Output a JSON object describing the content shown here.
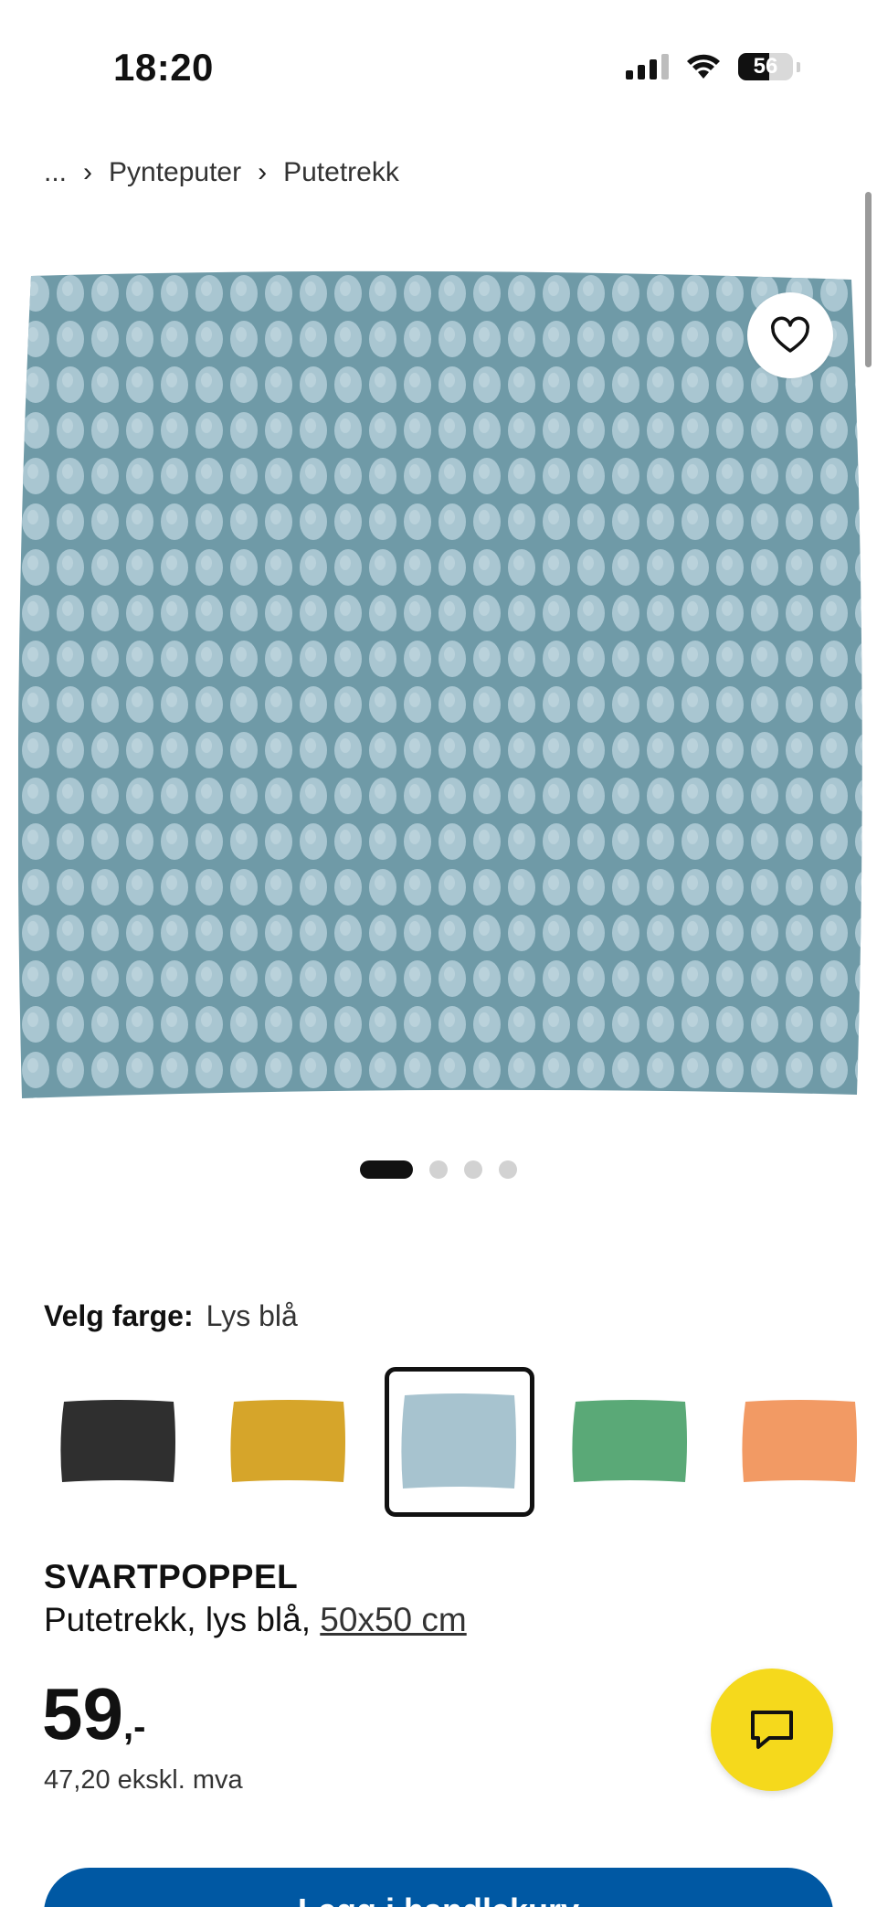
{
  "status_bar": {
    "time": "18:20",
    "battery": "56"
  },
  "breadcrumb": {
    "ellipsis": "...",
    "items": [
      "Pynteputer",
      "Putetrekk"
    ],
    "separator": "›"
  },
  "product": {
    "color_label": "Velg farge:",
    "color_value": "Lys blå",
    "swatches": [
      {
        "name": "black",
        "color": "#2f2f2f"
      },
      {
        "name": "yellow",
        "color": "#d6a52a"
      },
      {
        "name": "light-blue",
        "color": "#a7c3cf",
        "selected": true
      },
      {
        "name": "green",
        "color": "#5aa977"
      },
      {
        "name": "orange",
        "color": "#f29a64"
      }
    ],
    "carousel": {
      "count": 4,
      "active": 0
    },
    "brand": "SVARTPOPPEL",
    "description": "Putetrekk, lys blå,",
    "size": "50x50 cm",
    "price_integer": "59",
    "price_suffix": ",-",
    "price_excl": "47,20 ekskl. mva",
    "cart_label": "Legg i handlekurv"
  },
  "colors": {
    "accent_blue": "#0058a3",
    "chat_yellow": "#f5d91c",
    "pillow_base": "#6f9aa7",
    "pillow_dot": "#a9c6d1"
  }
}
